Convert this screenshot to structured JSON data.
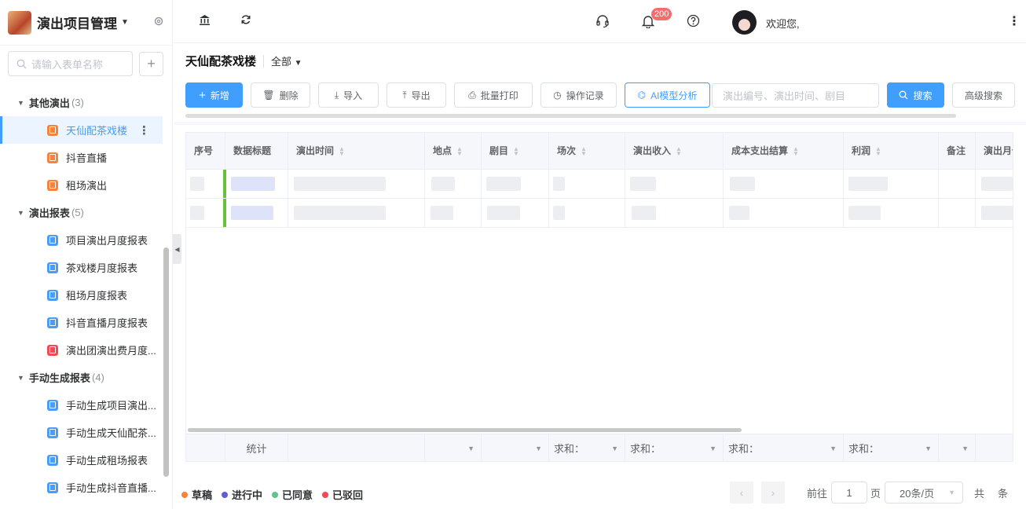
{
  "app": {
    "title": "演出项目管理"
  },
  "sidebar": {
    "search_placeholder": "请输入表单名称",
    "add_label": "+",
    "groups": [
      {
        "label": "其他演出",
        "count": "(3)",
        "items": [
          "天仙配茶戏楼",
          "抖音直播",
          "租场演出"
        ],
        "icon_colors": [
          "orange",
          "orange",
          "orange"
        ]
      },
      {
        "label": "演出报表",
        "count": "(5)",
        "items": [
          "项目演出月度报表",
          "茶戏楼月度报表",
          "租场月度报表",
          "抖音直播月度报表",
          "演出团演出费月度..."
        ],
        "icon_colors": [
          "blue",
          "blue",
          "blue",
          "blue",
          "red"
        ]
      },
      {
        "label": "手动生成报表",
        "count": "(4)",
        "items": [
          "手动生成项目演出...",
          "手动生成天仙配茶...",
          "手动生成租场报表",
          "手动生成抖音直播..."
        ],
        "icon_colors": [
          "blue",
          "blue",
          "blue",
          "blue"
        ]
      }
    ],
    "active_item": "天仙配茶戏楼"
  },
  "topbar": {
    "notification_count": "200",
    "welcome": "欢迎您,",
    "icons": [
      "bank-icon",
      "refresh-icon",
      "headset-icon",
      "bell-icon",
      "help-icon",
      "more-vertical-icon"
    ]
  },
  "page": {
    "title": "天仙配茶戏楼",
    "filter": "全部"
  },
  "toolbar": {
    "add": "新增",
    "delete": "删除",
    "import": "导入",
    "export": "导出",
    "batch_print": "批量打印",
    "op_log": "操作记录",
    "ai_analysis": "AI模型分析",
    "search_placeholder": "演出编号、演出时间、剧目",
    "search": "搜索",
    "advanced": "高级搜索"
  },
  "table": {
    "columns": [
      "序号",
      "数据标题",
      "演出时间",
      "地点",
      "剧目",
      "场次",
      "演出收入",
      "成本支出结算",
      "利润",
      "备注",
      "演出月份"
    ],
    "footer": {
      "label": "统计",
      "sum": "求和："
    }
  },
  "legend": [
    {
      "label": "草稿",
      "color": "#f5833d"
    },
    {
      "label": "进行中",
      "color": "#5b5fd6"
    },
    {
      "label": "已同意",
      "color": "#5ec48a"
    },
    {
      "label": "已驳回",
      "color": "#ef4b55"
    }
  ],
  "pagination": {
    "goto": "前往",
    "page": "1",
    "page_unit": "页",
    "page_size": "20条/页",
    "total_prefix": "共",
    "total_suffix": "条"
  }
}
